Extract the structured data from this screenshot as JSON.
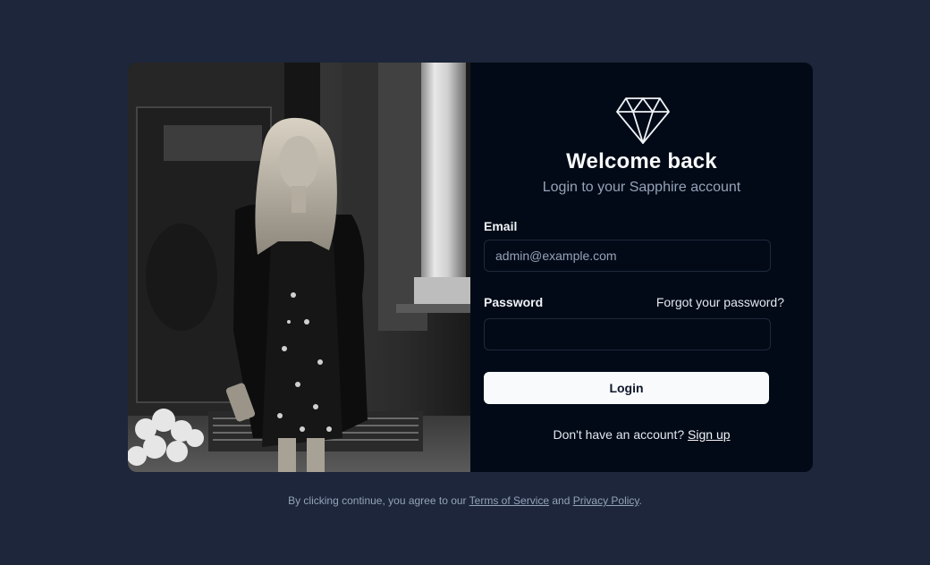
{
  "brand": {
    "logo_icon": "diamond-icon"
  },
  "heading": {
    "title": "Welcome back",
    "subtitle": "Login to your Sapphire account"
  },
  "form": {
    "email_label": "Email",
    "email_placeholder": "admin@example.com",
    "email_value": "",
    "password_label": "Password",
    "password_value": "",
    "forgot_link": "Forgot your password?",
    "submit_label": "Login"
  },
  "signup": {
    "prompt": "Don't have an account?",
    "link": "Sign up"
  },
  "footer": {
    "prefix": "By clicking continue, you agree to our",
    "terms_link": "Terms of Service",
    "conjunction": "and",
    "privacy_link": "Privacy Policy",
    "suffix": "."
  },
  "colors": {
    "page_background": "#1d263a",
    "card_background": "#030a17",
    "button_background": "#f8fafc",
    "muted_text": "#94a3b8"
  }
}
